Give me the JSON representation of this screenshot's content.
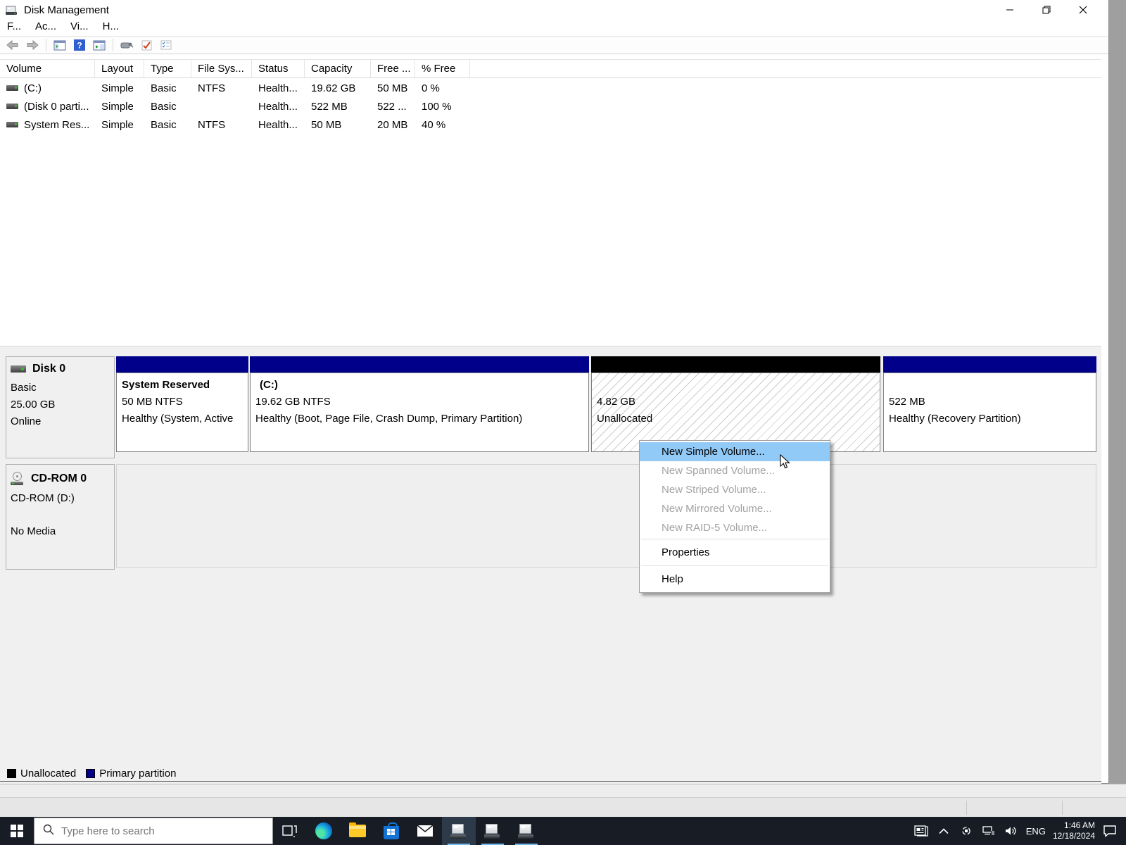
{
  "window": {
    "title": "Disk Management",
    "menu_items": [
      "F...",
      "Ac...",
      "Vi...",
      "H..."
    ]
  },
  "volume_table": {
    "columns": [
      "Volume",
      "Layout",
      "Type",
      "File Sys...",
      "Status",
      "Capacity",
      "Free ...",
      "% Free"
    ],
    "rows": [
      {
        "volume": "(C:)",
        "layout": "Simple",
        "type": "Basic",
        "fs": "NTFS",
        "status": "Health...",
        "capacity": "19.62 GB",
        "free": "50 MB",
        "pct_free": "0 %"
      },
      {
        "volume": "(Disk 0 parti...",
        "layout": "Simple",
        "type": "Basic",
        "fs": "",
        "status": "Health...",
        "capacity": "522 MB",
        "free": "522 ...",
        "pct_free": "100 %"
      },
      {
        "volume": "System Res...",
        "layout": "Simple",
        "type": "Basic",
        "fs": "NTFS",
        "status": "Health...",
        "capacity": "50 MB",
        "free": "20 MB",
        "pct_free": "40 %"
      }
    ]
  },
  "graph": {
    "disk0": {
      "name": "Disk 0",
      "kind": "Basic",
      "size": "25.00 GB",
      "status": "Online",
      "partitions": [
        {
          "name": "System Reserved",
          "detail": "50 MB NTFS",
          "status": "Healthy (System, Active"
        },
        {
          "name": "(C:)",
          "detail": "19.62 GB NTFS",
          "status": "Healthy (Boot, Page File, Crash Dump, Primary Partition)"
        },
        {
          "size": "4.82 GB",
          "status": "Unallocated"
        },
        {
          "size": "522 MB",
          "status": "Healthy (Recovery Partition)"
        }
      ]
    },
    "cdrom": {
      "name": "CD-ROM 0",
      "drive": "CD-ROM (D:)",
      "media": "No Media"
    }
  },
  "context_menu": {
    "items": [
      {
        "label": "New Simple Volume..."
      },
      {
        "label": "New Spanned Volume..."
      },
      {
        "label": "New Striped Volume..."
      },
      {
        "label": "New Mirrored Volume..."
      },
      {
        "label": "New RAID-5 Volume..."
      },
      {
        "label": "Properties"
      },
      {
        "label": "Help"
      }
    ]
  },
  "legend": {
    "unallocated": "Unallocated",
    "primary": "Primary partition"
  },
  "taskbar": {
    "search_placeholder": "Type here to search",
    "language": "ENG",
    "time": "1:46 AM",
    "date": "12/18/2024"
  },
  "colors": {
    "primary_partition_bar": "#00008b",
    "unallocated_bar": "#000000",
    "menu_highlight": "#91c9f7",
    "taskbar": "#171c25"
  },
  "icons": [
    "disk-management-app-icon",
    "minimize-icon",
    "restore-icon",
    "close-icon",
    "back-icon",
    "forward-icon",
    "console-tree-icon",
    "help-icon",
    "action-pane-icon",
    "device-icon",
    "check-icon",
    "checklist-icon",
    "volume-icon",
    "disk-icon",
    "cdrom-icon",
    "cursor-arrow-icon",
    "start-icon",
    "search-icon",
    "task-view-icon",
    "edge-icon",
    "file-explorer-icon",
    "store-icon",
    "mail-icon",
    "disk-management-taskbar-icon",
    "widgets-icon",
    "chevron-up-icon",
    "status-circle-icon",
    "network-icon",
    "speaker-icon",
    "action-center-icon"
  ]
}
